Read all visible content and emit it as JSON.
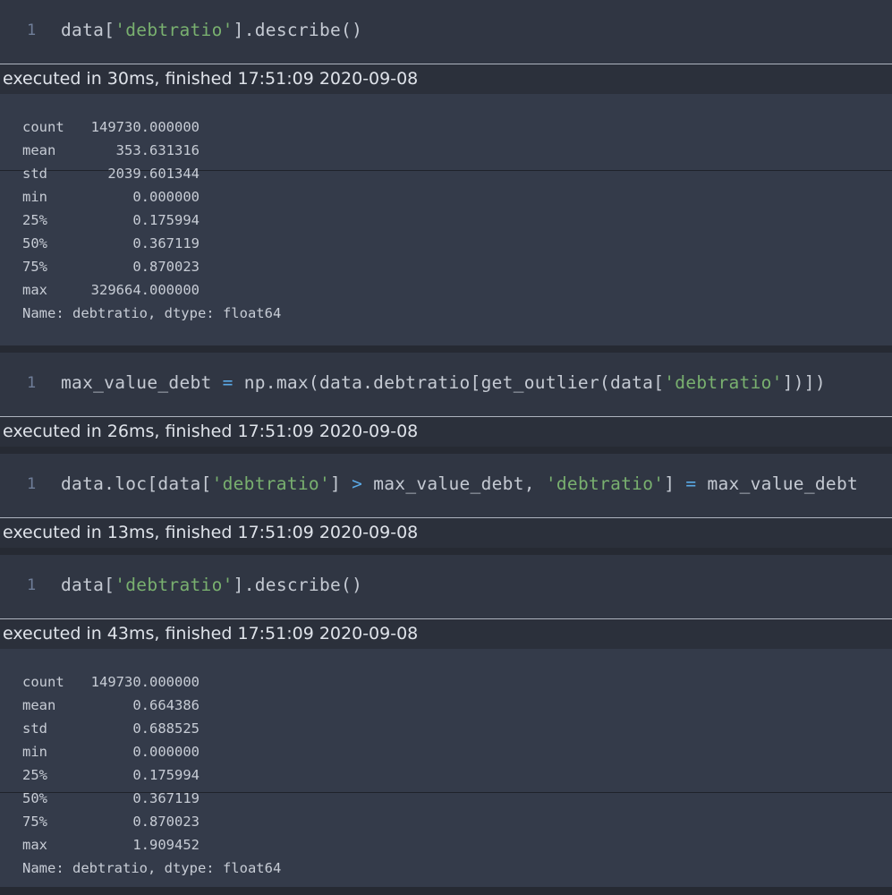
{
  "cells": [
    {
      "line_number": "1",
      "code_parts": [
        {
          "text": "data[",
          "kind": "plain"
        },
        {
          "text": "'debtratio'",
          "kind": "str"
        },
        {
          "text": "].describe()",
          "kind": "plain"
        }
      ],
      "timing": "executed in 30ms, finished 17:51:09 2020-09-08",
      "output": {
        "rows": [
          {
            "key": "count",
            "value": "149730.000000"
          },
          {
            "key": "mean",
            "value": "353.631316"
          },
          {
            "key": "std",
            "value": "2039.601344"
          },
          {
            "key": "min",
            "value": "0.000000"
          },
          {
            "key": "25%",
            "value": "0.175994"
          },
          {
            "key": "50%",
            "value": "0.367119"
          },
          {
            "key": "75%",
            "value": "0.870023"
          },
          {
            "key": "max",
            "value": "329664.000000"
          }
        ],
        "footer": "Name: debtratio, dtype: float64"
      }
    },
    {
      "line_number": "1",
      "code_parts": [
        {
          "text": "max_value_debt ",
          "kind": "plain"
        },
        {
          "text": "=",
          "kind": "op"
        },
        {
          "text": " np.max(data.debtratio[get_outlier(data[",
          "kind": "plain"
        },
        {
          "text": "'debtratio'",
          "kind": "str"
        },
        {
          "text": "])])",
          "kind": "plain"
        }
      ],
      "timing": "executed in 26ms, finished 17:51:09 2020-09-08"
    },
    {
      "line_number": "1",
      "code_parts": [
        {
          "text": "data.loc[data[",
          "kind": "plain"
        },
        {
          "text": "'debtratio'",
          "kind": "str"
        },
        {
          "text": "] ",
          "kind": "plain"
        },
        {
          "text": ">",
          "kind": "op"
        },
        {
          "text": " max_value_debt, ",
          "kind": "plain"
        },
        {
          "text": "'debtratio'",
          "kind": "str"
        },
        {
          "text": "] ",
          "kind": "plain"
        },
        {
          "text": "=",
          "kind": "op"
        },
        {
          "text": " max_value_debt",
          "kind": "plain"
        }
      ],
      "timing": "executed in 13ms, finished 17:51:09 2020-09-08"
    },
    {
      "line_number": "1",
      "code_parts": [
        {
          "text": "data[",
          "kind": "plain"
        },
        {
          "text": "'debtratio'",
          "kind": "str"
        },
        {
          "text": "].describe()",
          "kind": "plain"
        }
      ],
      "timing": "executed in 43ms, finished 17:51:09 2020-09-08",
      "output": {
        "rows": [
          {
            "key": "count",
            "value": "149730.000000"
          },
          {
            "key": "mean",
            "value": "0.664386"
          },
          {
            "key": "std",
            "value": "0.688525"
          },
          {
            "key": "min",
            "value": "0.000000"
          },
          {
            "key": "25%",
            "value": "0.175994"
          },
          {
            "key": "50%",
            "value": "0.367119"
          },
          {
            "key": "75%",
            "value": "0.870023"
          },
          {
            "key": "max",
            "value": "1.909452"
          }
        ],
        "footer": "Name: debtratio, dtype: float64"
      }
    }
  ]
}
